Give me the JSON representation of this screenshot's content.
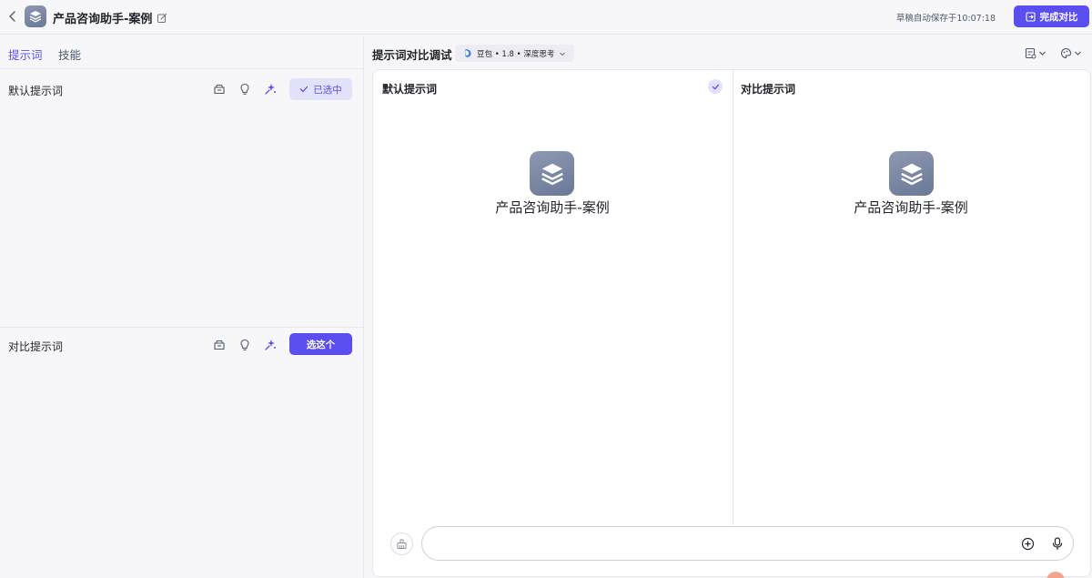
{
  "header": {
    "app_title": "产品咨询助手-案例",
    "autosave_text": "草稿自动保存于10:07:18",
    "finish_button_label": "完成对比"
  },
  "left_tabs": [
    {
      "label": "提示词",
      "active": true
    },
    {
      "label": "技能",
      "active": false
    }
  ],
  "default_prompt": {
    "title": "默认提示词",
    "selected_label": "已选中"
  },
  "compare_prompt": {
    "title": "对比提示词",
    "choose_label": "选这个"
  },
  "debug_panel": {
    "title": "提示词对比调试",
    "model_chip": "豆包 • 1.8 • 深度思考",
    "columns": [
      {
        "title": "默认提示词",
        "bot_name": "产品咨询助手-案例",
        "selected": true
      },
      {
        "title": "对比提示词",
        "bot_name": "产品咨询助手-案例",
        "selected": false
      }
    ],
    "input_placeholder": ""
  },
  "colors": {
    "accent": "#5b4ef0",
    "accent_light": "#e2e2fb",
    "background": "#f7f7fa",
    "avatar": "#7a86a3"
  },
  "icons": [
    "chevron-left-icon",
    "layers-icon",
    "edit-icon",
    "save-icon",
    "robot-icon",
    "bulb-icon",
    "sparkle-icon",
    "check-icon",
    "doubao-logo-icon",
    "chevron-down-icon",
    "layout-icon",
    "eye-settings-icon",
    "clear-icon",
    "plus-circle-icon",
    "mic-icon"
  ]
}
